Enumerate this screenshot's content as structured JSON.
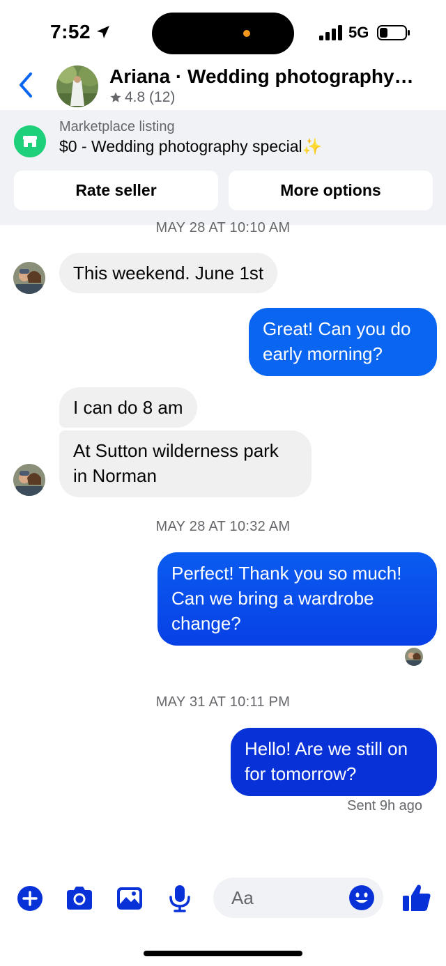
{
  "status_bar": {
    "time": "7:52",
    "network": "5G"
  },
  "header": {
    "title": "Ariana · Wedding photography…",
    "rating": "4.8 (12)"
  },
  "marketplace": {
    "label": "Marketplace listing",
    "title": "$0 - Wedding photography special",
    "title_emoji": "✨",
    "rate_button": "Rate seller",
    "more_button": "More options"
  },
  "messages": {
    "ts1": "MAY 28 AT 10:10 AM",
    "m1": "This weekend. June 1st",
    "m2_line1": "Great! Can you do",
    "m2_line2": "early morning?",
    "m3": "I can do 8 am",
    "m4_line1": "At Sutton wilderness park",
    "m4_line2": "in Norman",
    "ts2": "MAY 28 AT 10:32 AM",
    "m5_line1": "Perfect! Thank you so much!",
    "m5_line2": "Can we bring a wardrobe",
    "m5_line3": "change?",
    "ts3": "MAY 31 AT 10:11 PM",
    "m6_line1": "Hello! Are we still on",
    "m6_line2": "for tomorrow?",
    "sent_status": "Sent 9h ago"
  },
  "composer": {
    "placeholder": "Aa"
  },
  "colors": {
    "blue": "#0a66f0",
    "deep_blue": "#0832d8",
    "incoming": "#f0f0f0",
    "green": "#1fd07b"
  }
}
